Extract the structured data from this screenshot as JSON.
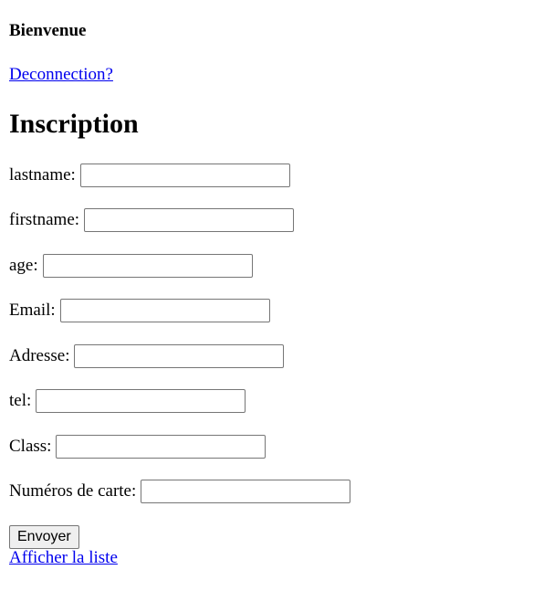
{
  "header": {
    "welcome": "Bienvenue",
    "logout_link": "Deconnection?"
  },
  "form": {
    "title": "Inscription",
    "fields": {
      "lastname": {
        "label": "lastname:",
        "value": ""
      },
      "firstname": {
        "label": "firstname:",
        "value": ""
      },
      "age": {
        "label": "age:",
        "value": ""
      },
      "email": {
        "label": "Email:",
        "value": ""
      },
      "adresse": {
        "label": "Adresse:",
        "value": ""
      },
      "tel": {
        "label": "tel:",
        "value": ""
      },
      "class": {
        "label": "Class:",
        "value": ""
      },
      "card_number": {
        "label": "Numéros de carte:",
        "value": ""
      }
    },
    "submit_label": "Envoyer"
  },
  "footer": {
    "list_link": "Afficher la liste"
  }
}
